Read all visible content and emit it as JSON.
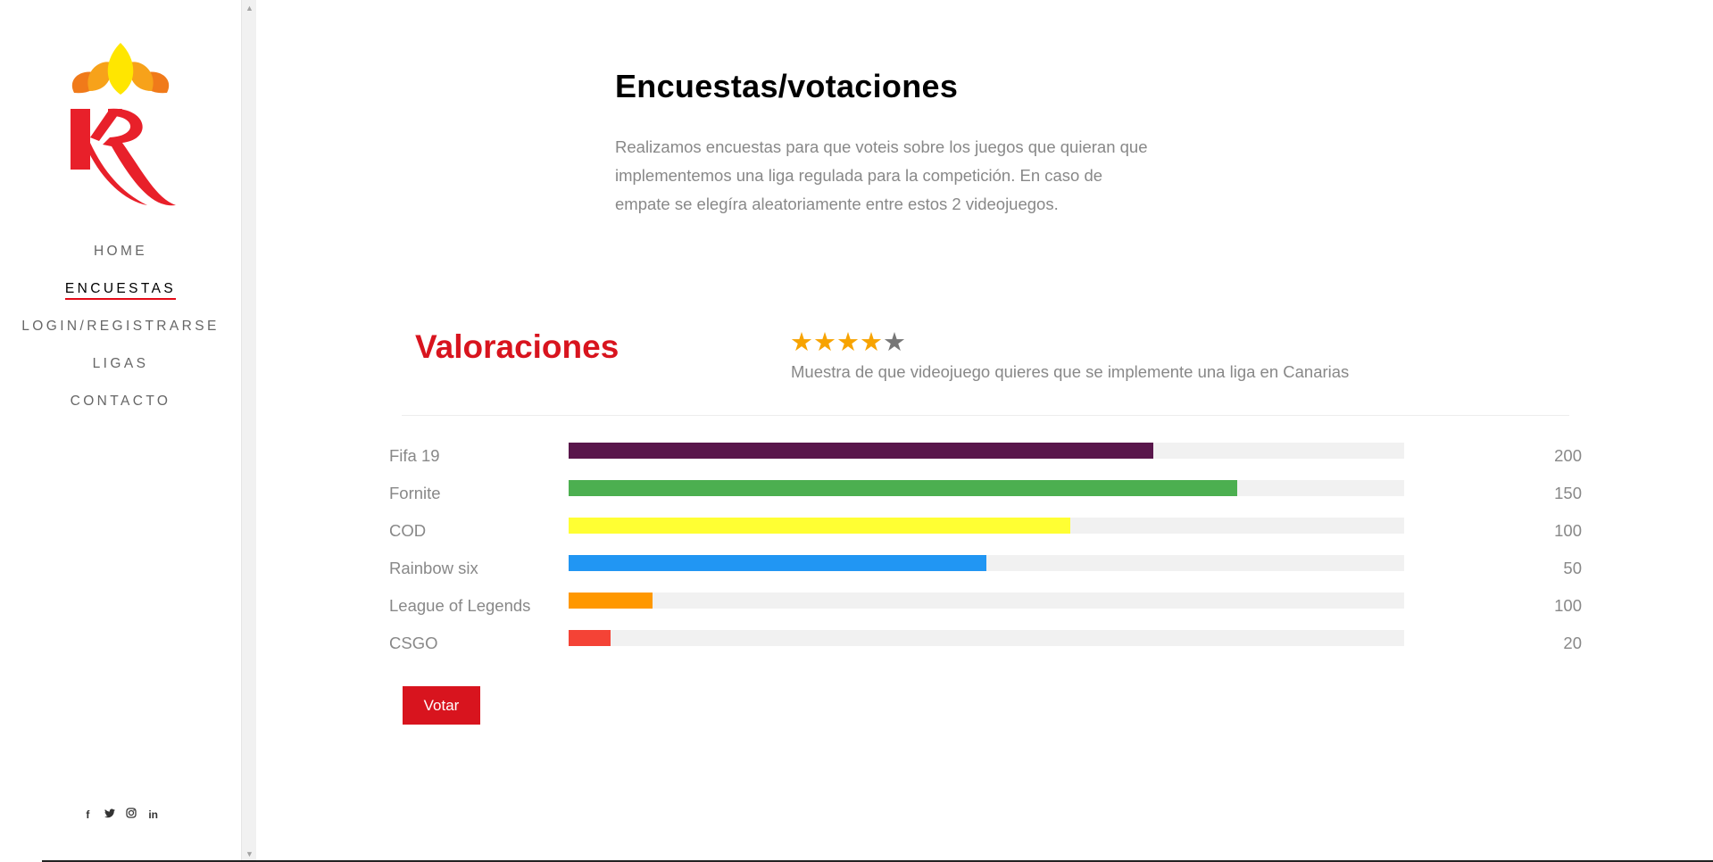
{
  "sidebar": {
    "logo_text": "KR",
    "nav": [
      {
        "label": "HOME",
        "active": false
      },
      {
        "label": "ENCUESTAS",
        "active": true
      },
      {
        "label": "LOGIN/REGISTRARSE",
        "active": false
      },
      {
        "label": "LIGAS",
        "active": false
      },
      {
        "label": "CONTACTO",
        "active": false
      }
    ],
    "social": [
      {
        "icon": "facebook-icon",
        "glyph": "f"
      },
      {
        "icon": "twitter-icon",
        "glyph": "🐦"
      },
      {
        "icon": "instagram-icon",
        "glyph": "◎"
      },
      {
        "icon": "linkedin-icon",
        "glyph": "in"
      }
    ]
  },
  "main": {
    "title": "Encuestas/votaciones",
    "intro": "Realizamos encuestas para que voteis sobre los juegos que quieran que implementemos una liga regulada para la competición. En caso de empate se elegíra aleatoriamente entre estos 2 videojuegos."
  },
  "ratings": {
    "title": "Valoraciones",
    "stars_filled": 4,
    "stars_total": 5,
    "caption": "Muestra de que videojuego quieres que se implemente una liga en Canarias",
    "rows": [
      {
        "label": "Fifa 19",
        "value": "200",
        "fill": 0.7,
        "color": "#59164b"
      },
      {
        "label": "Fornite",
        "value": "150",
        "fill": 0.8,
        "color": "#4caf50"
      },
      {
        "label": "COD",
        "value": "100",
        "fill": 0.6,
        "color": "#ffff33"
      },
      {
        "label": "Rainbow six",
        "value": "50",
        "fill": 0.5,
        "color": "#2196f3"
      },
      {
        "label": "League of Legends",
        "value": "100",
        "fill": 0.1,
        "color": "#ff9800"
      },
      {
        "label": "CSGO",
        "value": "20",
        "fill": 0.05,
        "color": "#f44336"
      }
    ],
    "vote_label": "Votar"
  },
  "colors": {
    "accent": "#d8141e",
    "star": "#f7a300",
    "star_off": "#777777"
  }
}
